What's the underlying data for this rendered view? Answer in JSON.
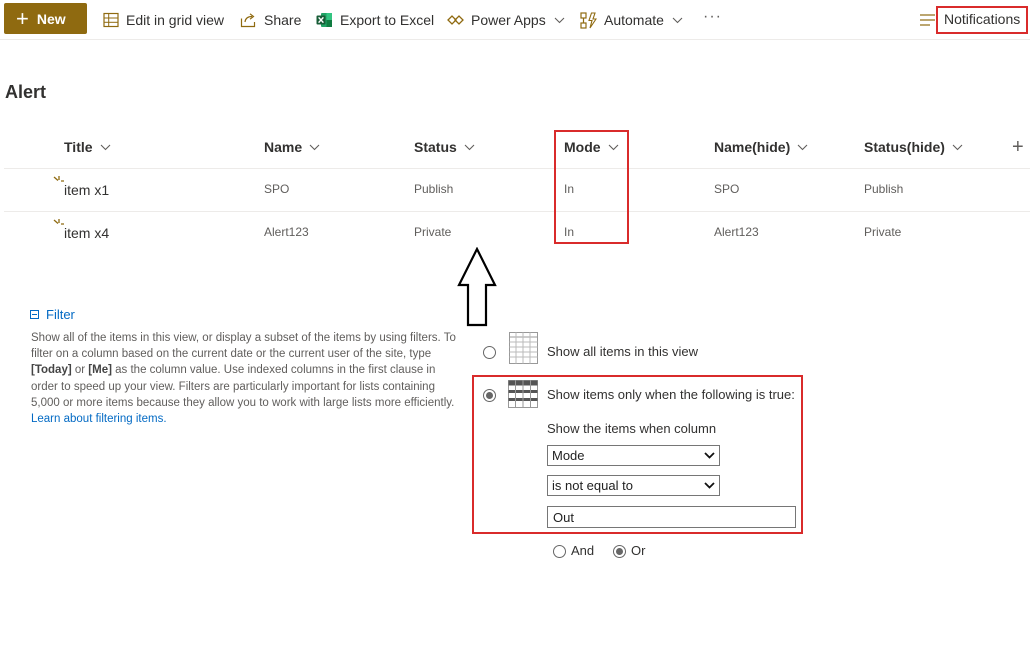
{
  "commandbar": {
    "new_label": "New",
    "grid_label": "Edit in grid view",
    "share_label": "Share",
    "excel_label": "Export to Excel",
    "powerapps_label": "Power Apps",
    "automate_label": "Automate",
    "more_label": "···",
    "notifications_label": "Notifications"
  },
  "page": {
    "title": "Alert"
  },
  "table": {
    "columns": [
      "Title",
      "Name",
      "Status",
      "Mode",
      "Name(hide)",
      "Status(hide)"
    ],
    "add_column": "+",
    "rows": [
      {
        "title": "item x1",
        "name": "SPO",
        "status": "Publish",
        "mode": "In",
        "name_hide": "SPO",
        "status_hide": "Publish"
      },
      {
        "title": "item x4",
        "name": "Alert123",
        "status": "Private",
        "mode": "In",
        "name_hide": "Alert123",
        "status_hide": "Private"
      }
    ]
  },
  "filter": {
    "heading": "Filter",
    "desc_1": "Show all of the items in this view, or display a subset of the items by using filters. To filter on a column based on the current date or the current user of the site, type ",
    "token_today": "[Today]",
    "desc_or": " or ",
    "token_me": "[Me]",
    "desc_2": " as the column value. Use indexed columns in the first clause in order to speed up your view. Filters are particularly important for lists containing 5,000 or more items because they allow you to work with large lists more efficiently. ",
    "learn_link": "Learn about filtering items.",
    "option_all": "Show all items in this view",
    "option_cond": "Show items only when the following is true:",
    "show_when": "Show the items when column",
    "column_value": "Mode",
    "operator_value": "is not equal to",
    "value_text": "Out",
    "and_label": "And",
    "or_label": "Or",
    "selected_option": "conditional",
    "selected_join": "Or"
  },
  "colors": {
    "accent": "#8f6a10",
    "highlight": "#d92b2b",
    "link": "#036ac4"
  }
}
